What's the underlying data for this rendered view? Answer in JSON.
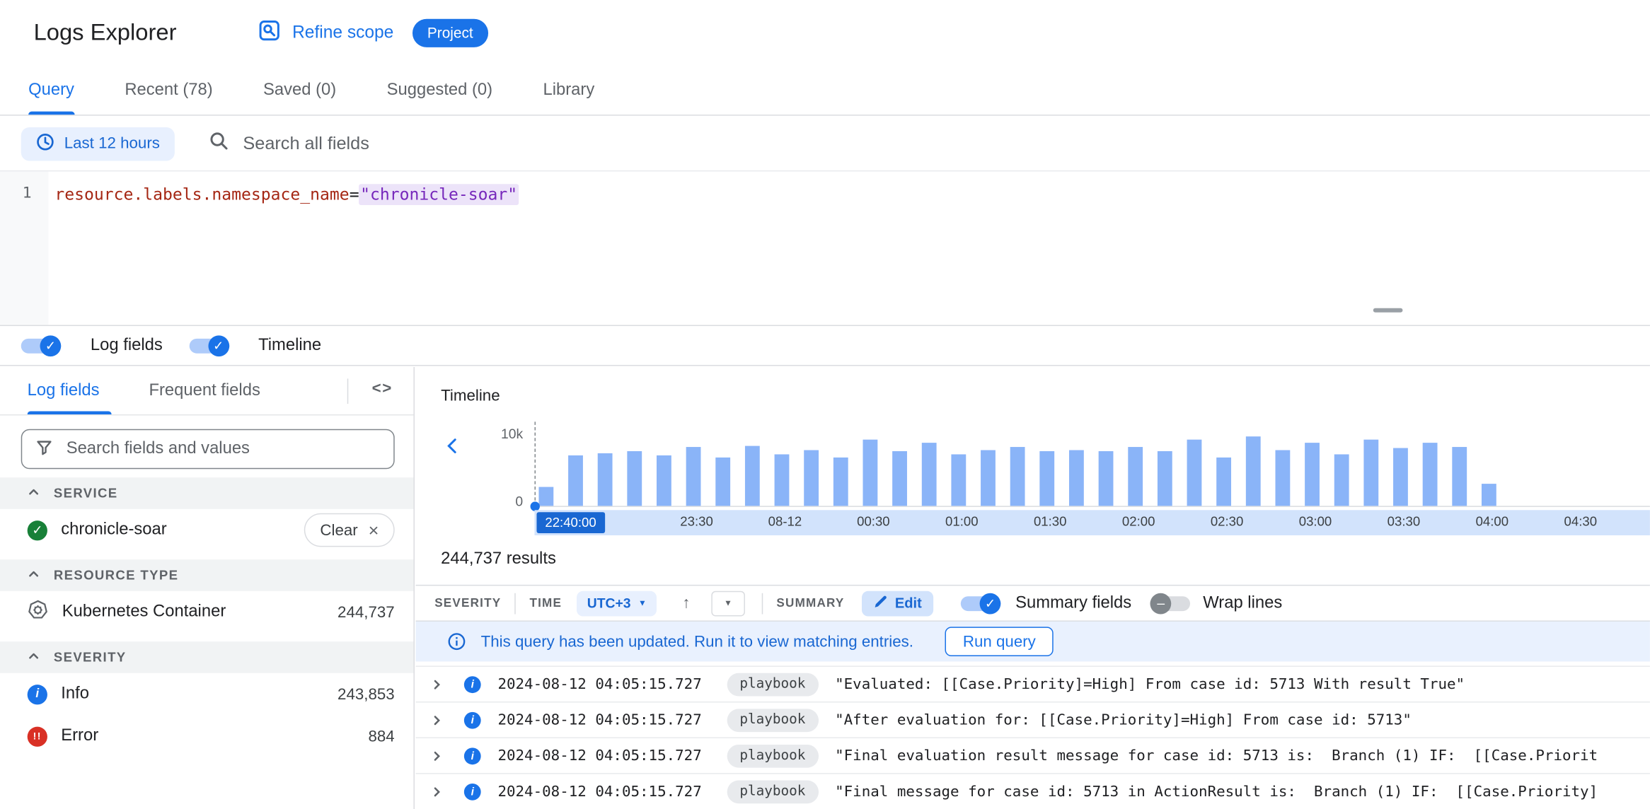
{
  "colors": {
    "accent": "#1a73e8",
    "link_blue": "#1967d2",
    "bar_fill": "#8ab4f8",
    "axis_strip": "#d2e3fc",
    "success_green": "#188038",
    "error_red": "#d93025",
    "chip_gray": "#e8eaed"
  },
  "header": {
    "title": "Logs Explorer",
    "refine_scope": "Refine scope",
    "project_badge": "Project"
  },
  "tabs": [
    {
      "label": "Query"
    },
    {
      "label": "Recent (78)"
    },
    {
      "label": "Saved (0)"
    },
    {
      "label": "Suggested (0)"
    },
    {
      "label": "Library"
    }
  ],
  "query_bar": {
    "time_range": "Last 12 hours",
    "search_placeholder": "Search all fields"
  },
  "editor": {
    "line_number": "1",
    "key": "resource.labels.namespace_name",
    "operator": "=",
    "value": "\"chronicle-soar\""
  },
  "panel_toggles": {
    "log_fields_label": "Log fields",
    "timeline_label": "Timeline"
  },
  "sidebar": {
    "tabs": [
      {
        "label": "Log fields"
      },
      {
        "label": "Frequent fields"
      }
    ],
    "search_placeholder": "Search fields and values",
    "sections": [
      {
        "title": "SERVICE",
        "items": [
          {
            "icon": "check-circle",
            "label": "chronicle-soar",
            "action": "Clear"
          }
        ]
      },
      {
        "title": "RESOURCE TYPE",
        "items": [
          {
            "icon": "kubernetes",
            "label": "Kubernetes Container",
            "count": "244,737"
          }
        ]
      },
      {
        "title": "SEVERITY",
        "items": [
          {
            "icon": "info",
            "label": "Info",
            "count": "243,853"
          },
          {
            "icon": "error",
            "label": "Error",
            "count": "884"
          }
        ]
      }
    ]
  },
  "timeline": {
    "title": "Timeline",
    "selected_time": "22:40:00",
    "axis_labels": [
      "23:30",
      "08-12",
      "00:30",
      "01:00",
      "01:30",
      "02:00",
      "02:30",
      "03:00",
      "03:30",
      "04:00",
      "04:30"
    ]
  },
  "chart_data": {
    "type": "bar",
    "title": "Timeline",
    "ylabel": "",
    "y_axis": {
      "min_label": "0",
      "max_label": "10k",
      "min": 0,
      "max": 10000
    },
    "x_axis_labels": [
      "22:40:00",
      "23:30",
      "08-12",
      "00:30",
      "01:00",
      "01:30",
      "02:00",
      "02:30",
      "03:00",
      "03:30",
      "04:00",
      "04:30"
    ],
    "values": [
      2600,
      6800,
      7200,
      7400,
      6900,
      8000,
      6600,
      8200,
      7000,
      7600,
      6600,
      9000,
      7400,
      8600,
      7000,
      7600,
      8000,
      7400,
      7600,
      7400,
      8000,
      7400,
      9000,
      6600,
      9400,
      7600,
      8600,
      7000,
      9000,
      7800,
      8600,
      8000,
      3000
    ],
    "bar_color": "#8ab4f8",
    "grid": false,
    "legend": false
  },
  "results": {
    "count_text": "244,737 results",
    "toolbar": {
      "severity": "SEVERITY",
      "time": "TIME",
      "timezone": "UTC+3",
      "summary": "SUMMARY",
      "edit": "Edit",
      "summary_fields": "Summary fields",
      "wrap_lines": "Wrap lines"
    },
    "banner": {
      "message": "This query has been updated. Run it to view matching entries.",
      "button": "Run query"
    },
    "rows": [
      {
        "timestamp": "2024-08-12 04:05:15.727",
        "chip": "playbook",
        "message": "\"Evaluated: [[Case.Priority]=High] From case id: 5713 With result True\""
      },
      {
        "timestamp": "2024-08-12 04:05:15.727",
        "chip": "playbook",
        "message": "\"After evaluation for: [[Case.Priority]=High] From case id: 5713\""
      },
      {
        "timestamp": "2024-08-12 04:05:15.727",
        "chip": "playbook",
        "message": "\"Final evaluation result message for case id: 5713 is:  Branch (1) IF:  [[Case.Priorit"
      },
      {
        "timestamp": "2024-08-12 04:05:15.727",
        "chip": "playbook",
        "message": "\"Final message for case id: 5713 in ActionResult is:  Branch (1) IF:  [[Case.Priority]"
      }
    ]
  }
}
